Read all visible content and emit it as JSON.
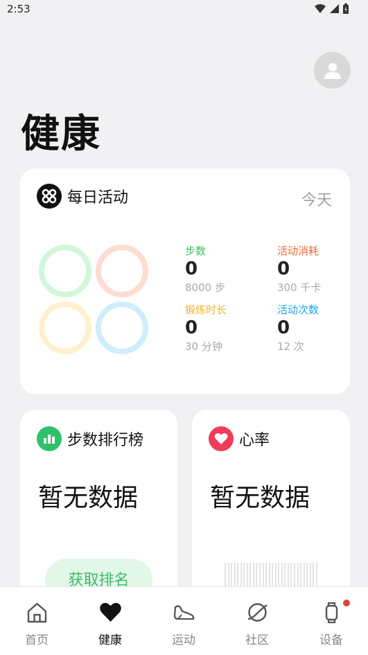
{
  "status_bar": {
    "time": "2:53"
  },
  "page": {
    "title": "健康"
  },
  "daily_activity": {
    "title": "每日活动",
    "date_label": "今天",
    "stats": [
      {
        "label": "步数",
        "value": "0",
        "target": "8000 步",
        "color": "#3bbf5a"
      },
      {
        "label": "活动消耗",
        "value": "0",
        "target": "300 千卡",
        "color": "#ee6a3c"
      },
      {
        "label": "锻炼时长",
        "value": "0",
        "target": "30 分钟",
        "color": "#f0b726"
      },
      {
        "label": "活动次数",
        "value": "0",
        "target": "12 次",
        "color": "#19a9e8"
      }
    ],
    "ring_colors": [
      "#d3f6da",
      "#ffdcd2",
      "#fff1cd",
      "#cfeefc"
    ]
  },
  "step_ranking": {
    "title": "步数排行榜",
    "no_data": "暂无数据",
    "button_label": "获取排名",
    "icon_color": "#2fc26a"
  },
  "heart_rate": {
    "title": "心率",
    "no_data": "暂无数据",
    "icon_color": "#f03c5a"
  },
  "tabs": [
    {
      "label": "首页",
      "icon": "home-icon",
      "active": false
    },
    {
      "label": "健康",
      "icon": "heart-icon",
      "active": true
    },
    {
      "label": "运动",
      "icon": "shoe-icon",
      "active": false
    },
    {
      "label": "社区",
      "icon": "planet-icon",
      "active": false
    },
    {
      "label": "设备",
      "icon": "watch-icon",
      "active": false,
      "badge": true
    }
  ]
}
